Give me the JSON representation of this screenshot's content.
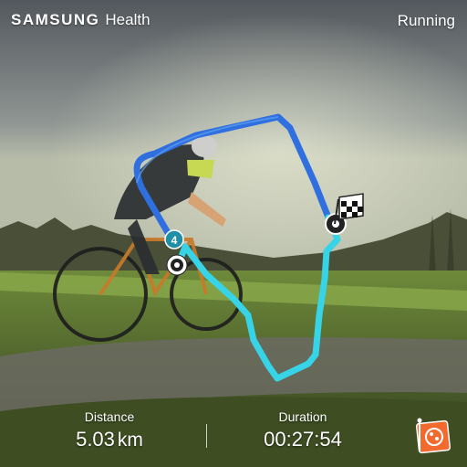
{
  "header": {
    "brand_samsung": "SAMSUNG",
    "brand_health": "Health",
    "activity": "Running"
  },
  "route": {
    "lap_marker": "4",
    "route_color_dark": "#2f6fe0",
    "route_color_light": "#37d3e6"
  },
  "stats": {
    "distance_label": "Distance",
    "distance_value": "5.03",
    "distance_unit": "km",
    "duration_label": "Duration",
    "duration_value": "00:27:54"
  },
  "share": {
    "icon": "share-sticker-icon",
    "color": "#f26a2e"
  }
}
